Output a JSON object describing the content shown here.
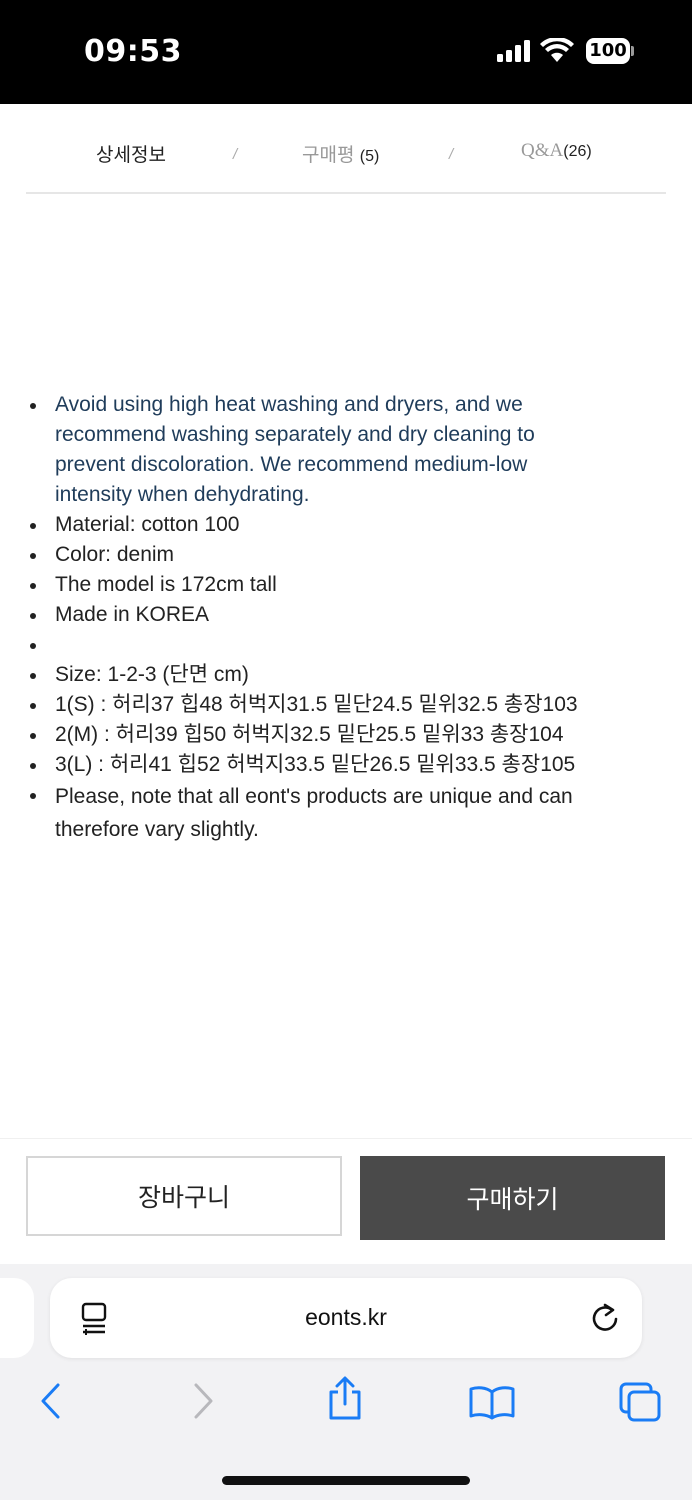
{
  "status_bar": {
    "time": "09:53",
    "battery": "100",
    "icons": [
      "signal-icon",
      "wifi-icon",
      "battery-icon"
    ]
  },
  "tabs": {
    "detail": "상세정보",
    "reviews_label": "구매평",
    "reviews_count": "(5)",
    "qna_label": "Q&A",
    "qna_count": "(26)",
    "separator": "/"
  },
  "details": {
    "care_note": "Avoid using high heat washing and dryers, and we recommend washing separately and dry cleaning to prevent discoloration. We recommend medium-low intensity when dehydrating.",
    "material": "Material: cotton 100",
    "color": "Color: denim",
    "model": "The model is 172cm tall",
    "origin": "Made in KOREA",
    "size_header": "Size: 1-2-3 (단면 cm)",
    "size_1": "1(S) : 허리37 힙48 허벅지31.5 밑단24.5 밑위32.5 총장103",
    "size_2": "2(M) : 허리39 힙50 허벅지32.5 밑단25.5 밑위33 총장104",
    "size_3": "3(L) : 허리41 힙52 허벅지33.5 밑단26.5 밑위33.5 총장105",
    "note": "Please, note that all eont's products are unique and can therefore vary slightly."
  },
  "actions": {
    "cart": "장바구니",
    "buy": "구매하기"
  },
  "browser": {
    "url": "eonts.kr",
    "icons": [
      "reader-icon",
      "reload-icon",
      "back-icon",
      "forward-icon",
      "share-icon",
      "bookmarks-icon",
      "tabs-icon"
    ],
    "accent": "#1a7cf5"
  }
}
